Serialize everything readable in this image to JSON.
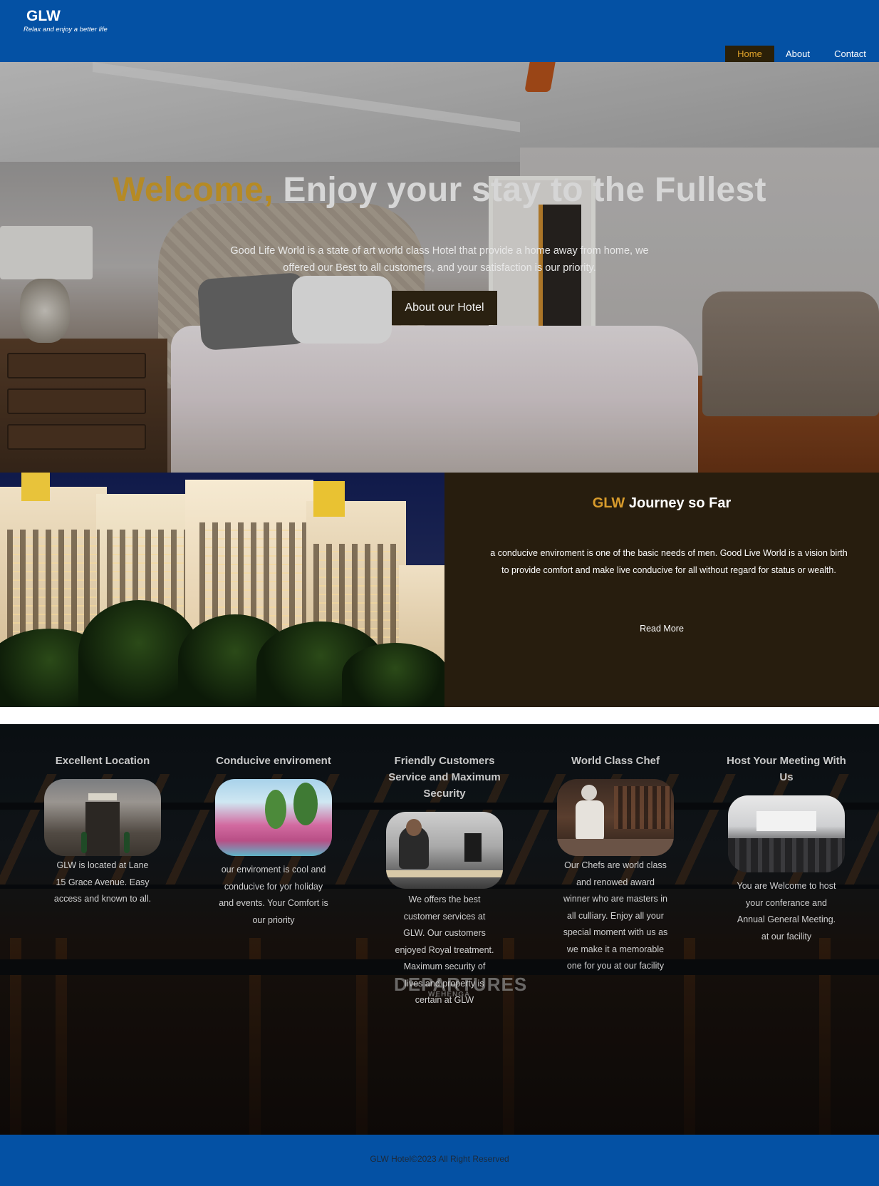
{
  "brand": {
    "name": "GLW",
    "tagline": "Relax and enjoy a better life"
  },
  "nav": {
    "items": [
      {
        "label": "Home",
        "active": true
      },
      {
        "label": "About",
        "active": false
      },
      {
        "label": "Contact",
        "active": false
      }
    ]
  },
  "hero": {
    "title_accent": "Welcome,",
    "title_rest": " Enjoy your stay to the Fullest",
    "description": "Good Life World is a state of art world class Hotel that provide a home away from home, we offered our Best to all customers, and your satisfaction is our priority.",
    "button": "About our Hotel"
  },
  "journey": {
    "title_accent": "GLW",
    "title_rest": " Journey so Far",
    "text": "a conducive enviroment is one of the basic needs of men. Good Live World is a vision birth to provide comfort and make live conducive for all without regard for status or wealth.",
    "link": "Read More"
  },
  "features": [
    {
      "title": "Excellent Location",
      "text": "GLW is located at Lane 15 Grace Avenue. Easy access and known to all."
    },
    {
      "title": "Conducive enviroment",
      "text": "our enviroment is cool and conducive for yor holiday and events. Your Comfort is our priority"
    },
    {
      "title": "Friendly Customers Service and Maximum Security",
      "text": "We offers the best customer services at GLW. Our customers enjoyed Royal treatment. Maximum security of lives and property is certain at GLW"
    },
    {
      "title": "World Class Chef",
      "text": "Our Chefs are world class and renowed award winner who are masters in all culliary. Enjoy all your special moment with us as we make it a memorable one for you at our facility"
    },
    {
      "title": "Host Your Meeting With Us",
      "text": "You are Welcome to host your conferance and Annual General Meeting. at our facility"
    }
  ],
  "background_signage": {
    "main": "DEPARTURES",
    "sub": "WEHENGA"
  },
  "footer": {
    "text": "GLW Hotel©2023 All Right Reserved"
  },
  "colors": {
    "brand_blue": "#0451a4",
    "accent_gold": "#b58a25",
    "dark_brown": "#271d0e"
  }
}
